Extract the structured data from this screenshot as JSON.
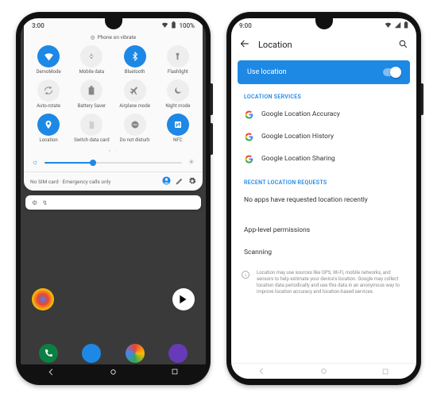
{
  "accent": "#1e88e5",
  "phone1": {
    "status": {
      "time": "3:00",
      "battery": "100%"
    },
    "vibrate": "Phone on vibrate",
    "tiles": [
      {
        "label": "DemoMode",
        "icon": "wifi-icon",
        "on": true
      },
      {
        "label": "Mobile data",
        "icon": "mobile-data-icon",
        "on": false
      },
      {
        "label": "Bluetooth",
        "icon": "bluetooth-icon",
        "on": true
      },
      {
        "label": "Flashlight",
        "icon": "flashlight-icon",
        "on": false
      },
      {
        "label": "Auto-rotate",
        "icon": "rotate-icon",
        "on": false
      },
      {
        "label": "Battery Saver",
        "icon": "battery-icon",
        "on": false
      },
      {
        "label": "Airplane mode",
        "icon": "airplane-icon",
        "on": false
      },
      {
        "label": "Night mode",
        "icon": "moon-icon",
        "on": false
      },
      {
        "label": "Location",
        "icon": "location-icon",
        "on": true
      },
      {
        "label": "Switch data card",
        "icon": "sim-icon",
        "on": false
      },
      {
        "label": "Do not disturb",
        "icon": "dnd-icon",
        "on": false
      },
      {
        "label": "NFC",
        "icon": "nfc-icon",
        "on": true
      }
    ],
    "brightness_pct": 35,
    "sim_text": "No SIM card · Emergency calls only"
  },
  "phone2": {
    "status": {
      "time": "9:00"
    },
    "title": "Location",
    "use_location": "Use location",
    "section_services": "LOCATION SERVICES",
    "services": [
      "Google Location Accuracy",
      "Google Location History",
      "Google Location Sharing"
    ],
    "section_recent": "RECENT LOCATION REQUESTS",
    "recent_empty": "No apps have requested location recently",
    "app_level": "App-level permissions",
    "scanning": "Scanning",
    "footer": "Location may use sources like GPS, Wi-Fi, mobile networks, and sensors to help estimate your device's location. Google may collect location data periodically and use this data in an anonymous way to improve location accuracy and location-based services."
  }
}
